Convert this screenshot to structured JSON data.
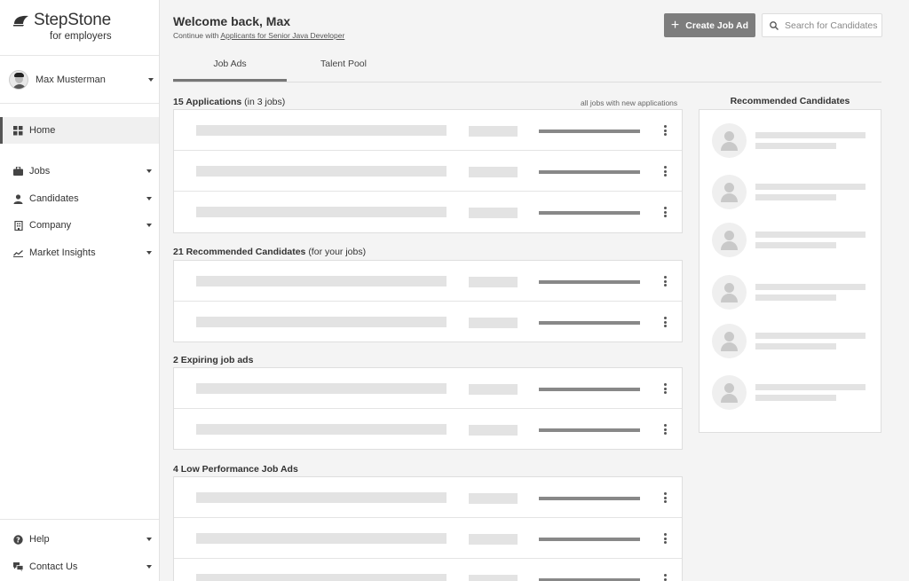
{
  "brand": {
    "name": "StepStone",
    "subtitle": "for employers"
  },
  "user": {
    "name": "Max Musterman"
  },
  "nav": {
    "home": "Home",
    "jobs": "Jobs",
    "candidates": "Candidates",
    "company": "Company",
    "market_insights": "Market Insights",
    "help": "Help",
    "contact": "Contact Us"
  },
  "header": {
    "welcome": "Welcome back, Max",
    "continue_prefix": "Continue with",
    "continue_link": "Applicants for Senior Java Developer",
    "create_button": "Create Job Ad",
    "search_placeholder": "Search for Candidates"
  },
  "tabs": {
    "job_ads": "Job Ads",
    "talent_pool": "Talent Pool"
  },
  "sections": {
    "applications": {
      "title": "15 Applications",
      "suffix": "(in 3 jobs)",
      "link": "all jobs with new applications"
    },
    "recommended": {
      "title": "21 Recommended Candidates",
      "suffix": "(for your jobs)"
    },
    "expiring": {
      "title": "2 Expiring job ads"
    },
    "low_performance": {
      "title": "4 Low Performance Job Ads"
    }
  },
  "recommended_panel": {
    "title": "Recommended Candidates"
  },
  "colors": {
    "primary_button": "#7d7d7d",
    "background": "#f4f4f4",
    "active_nav": "#555555"
  }
}
